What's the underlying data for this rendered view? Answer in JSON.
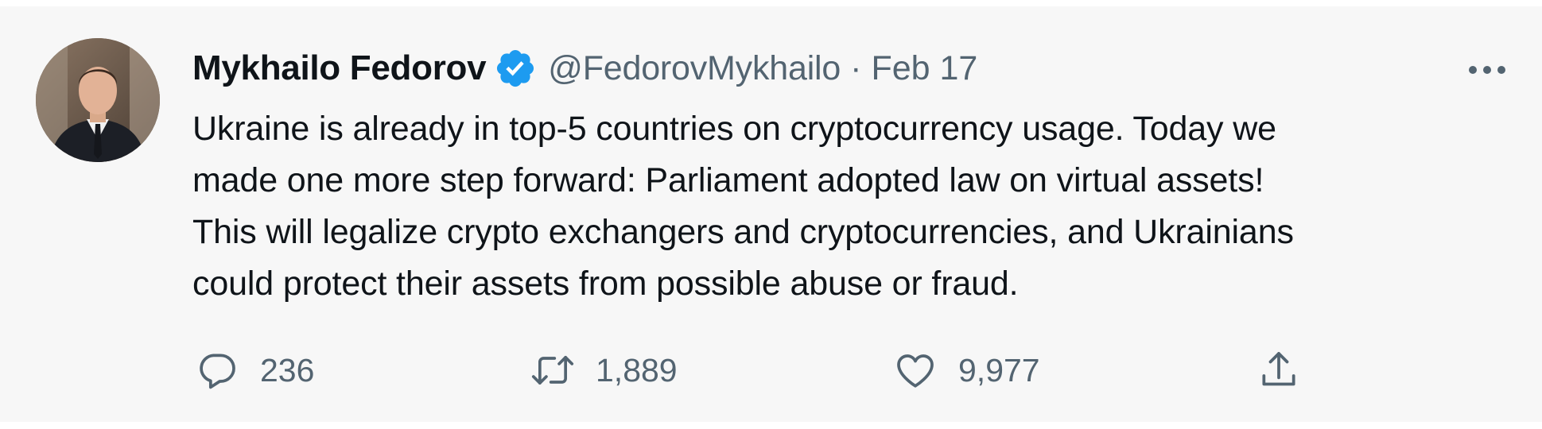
{
  "tweet": {
    "author": {
      "display_name": "Mykhailo Fedorov",
      "handle": "@FedorovMykhailo",
      "verified": true
    },
    "separator": "·",
    "date": "Feb 17",
    "text_lines": [
      "Ukraine is already in top-5 countries on cryptocurrency usage. Today we",
      "made one more step forward: Parliament adopted law on virtual assets!",
      "This will legalize crypto exchangers and cryptocurrencies, and Ukrainians",
      "could protect their assets from possible abuse or fraud."
    ],
    "actions": {
      "replies": "236",
      "retweets": "1,889",
      "likes": "9,977"
    }
  },
  "icons": {
    "verified": "verified-badge-icon",
    "more": "more-horizontal-icon",
    "reply": "reply-bubble-icon",
    "retweet": "retweet-icon",
    "like": "heart-icon",
    "share": "share-upload-icon"
  },
  "colors": {
    "background": "#f7f7f7",
    "text": "#0f1419",
    "secondary_text": "#536471",
    "verified_blue": "#1d9bf0"
  }
}
